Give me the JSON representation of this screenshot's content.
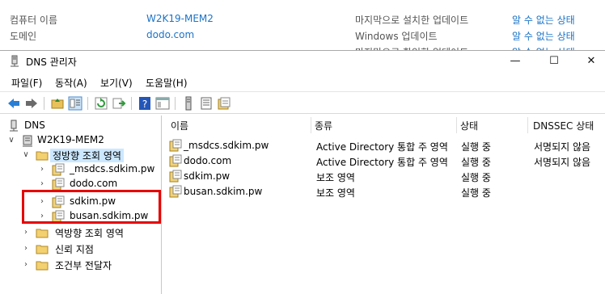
{
  "background": {
    "computer_name_label": "컴퓨터 이름",
    "computer_name_value": "W2K19-MEM2",
    "domain_label": "도메인",
    "domain_value": "dodo.com",
    "last_update_label": "마지막으로 설치한 업데이트",
    "last_update_value": "알 수 없는 상태",
    "windows_update_label": "Windows 업데이트",
    "windows_update_value": "알 수 없는 상태",
    "partial_row_label": "마지막으로 확인한 업데이트",
    "partial_row_value": "알 수 없는 상태"
  },
  "window": {
    "title": "DNS 관리자",
    "minimize": "—",
    "maximize": "☐",
    "close": "✕"
  },
  "menu": {
    "file": "파일(F)",
    "action": "동작(A)",
    "view": "보기(V)",
    "help": "도움말(H)"
  },
  "tree": {
    "root": "DNS",
    "server": "W2K19-MEM2",
    "forward_zones": "정방향 조회 영역",
    "zones": [
      "_msdcs.sdkim.pw",
      "dodo.com",
      "sdkim.pw",
      "busan.sdkim.pw"
    ],
    "reverse_zones": "역방향 조회 영역",
    "trust_points": "신뢰 지점",
    "conditional_forwarders": "조건부 전달자"
  },
  "list": {
    "columns": [
      "이름",
      "종류",
      "상태",
      "DNSSEC 상태"
    ],
    "rows": [
      {
        "name": "_msdcs.sdkim.pw",
        "type": "Active Directory 통합 주 영역",
        "status": "실행 중",
        "dnssec": "서명되지 않음"
      },
      {
        "name": "dodo.com",
        "type": "Active Directory 통합 주 영역",
        "status": "실행 중",
        "dnssec": "서명되지 않음"
      },
      {
        "name": "sdkim.pw",
        "type": "보조 영역",
        "status": "실행 중",
        "dnssec": ""
      },
      {
        "name": "busan.sdkim.pw",
        "type": "보조 영역",
        "status": "실행 중",
        "dnssec": ""
      }
    ]
  },
  "colors": {
    "link": "#1a73c8",
    "selection": "#cce8ff",
    "highlight_box": "#e60000"
  }
}
